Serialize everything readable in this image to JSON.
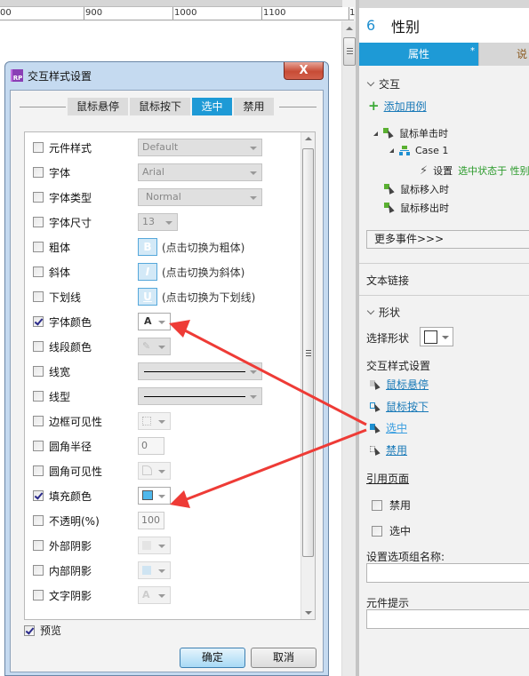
{
  "ruler": {
    "labels": [
      "00",
      "900",
      "1000",
      "1100",
      "1"
    ]
  },
  "dialog": {
    "title": "交互样式设置",
    "close_label": "X",
    "tabs": [
      {
        "label": "鼠标悬停",
        "active": false
      },
      {
        "label": "鼠标按下",
        "active": false
      },
      {
        "label": "选中",
        "active": true
      },
      {
        "label": "禁用",
        "active": false
      }
    ],
    "rows": [
      {
        "label": "元件样式",
        "checked": false,
        "control": "dropdown",
        "value": "Default"
      },
      {
        "label": "字体",
        "checked": false,
        "control": "dropdown",
        "value": "Arial"
      },
      {
        "label": "字体类型",
        "checked": false,
        "control": "dropdown",
        "value": "Normal"
      },
      {
        "label": "字体尺寸",
        "checked": false,
        "control": "dropdown-small",
        "value": "13"
      },
      {
        "label": "粗体",
        "checked": false,
        "control": "toggle",
        "glyph": "B",
        "hint": "(点击切换为粗体)"
      },
      {
        "label": "斜体",
        "checked": false,
        "control": "toggle",
        "glyph": "I",
        "hint": "(点击切换为斜体)"
      },
      {
        "label": "下划线",
        "checked": false,
        "control": "toggle",
        "glyph": "U",
        "hint": "(点击切换为下划线)"
      },
      {
        "label": "字体颜色",
        "checked": true,
        "control": "color",
        "glyph": "A"
      },
      {
        "label": "线段颜色",
        "checked": false,
        "control": "color-disabled",
        "glyph": "pen-icon"
      },
      {
        "label": "线宽",
        "checked": false,
        "control": "line"
      },
      {
        "label": "线型",
        "checked": false,
        "control": "line"
      },
      {
        "label": "边框可见性",
        "checked": false,
        "control": "border-visibility"
      },
      {
        "label": "圆角半径",
        "checked": false,
        "control": "number",
        "value": "0"
      },
      {
        "label": "圆角可见性",
        "checked": false,
        "control": "corner-visibility"
      },
      {
        "label": "填充颜色",
        "checked": true,
        "control": "fill",
        "color": "#4fb8ec"
      },
      {
        "label": "不透明(%)",
        "checked": false,
        "control": "number",
        "value": "100"
      },
      {
        "label": "外部阴影",
        "checked": false,
        "control": "shadow"
      },
      {
        "label": "内部阴影",
        "checked": false,
        "control": "shadow"
      },
      {
        "label": "文字阴影",
        "checked": false,
        "control": "text-shadow",
        "glyph": "A"
      }
    ],
    "preview_label": "预览",
    "preview_checked": true,
    "ok_label": "确定",
    "cancel_label": "取消"
  },
  "panel": {
    "widget_number": "6",
    "widget_name": "性别",
    "tabs": [
      {
        "label": "属性",
        "active": true,
        "marker": "*"
      },
      {
        "label": "说",
        "active": false
      }
    ],
    "interaction": {
      "section_label": "交互",
      "add_case_label": "添加用例",
      "events": [
        {
          "label": "鼠标单击时",
          "expanded": true
        },
        {
          "label": "鼠标移入时"
        },
        {
          "label": "鼠标移出时"
        }
      ],
      "case_label": "Case 1",
      "action_prefix": "设置",
      "action_text": "选中状态于 性别",
      "more_events_label": "更多事件>>>"
    },
    "text_link_label": "文本链接",
    "shape": {
      "section_label": "形状",
      "select_shape_label": "选择形状",
      "interaction_styles_label": "交互样式设置",
      "style_links": [
        "鼠标悬停",
        "鼠标按下",
        "选中",
        "禁用"
      ],
      "reference_page_label": "引用页面",
      "disabled_label": "禁用",
      "selected_label": "选中",
      "option_group_label": "设置选项组名称:",
      "option_group_value": "",
      "tooltip_label": "元件提示",
      "tooltip_value": ""
    }
  },
  "colors": {
    "accent": "#1e9ad6",
    "annotation_arrow": "#ee3b36",
    "link": "#1a7ab8",
    "green": "#2a9a2a"
  }
}
